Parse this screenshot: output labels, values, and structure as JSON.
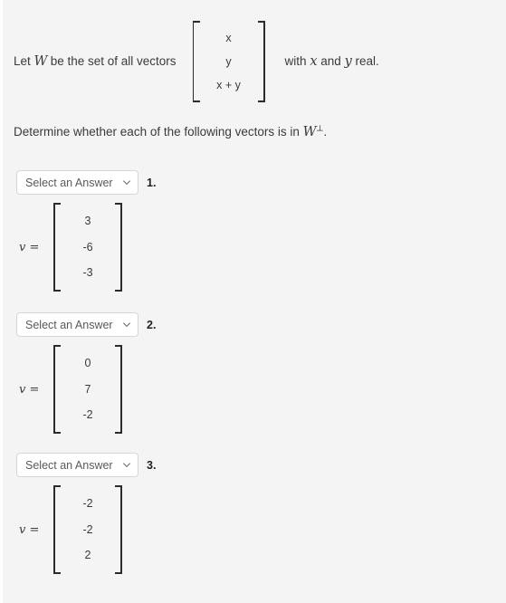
{
  "prompt": {
    "lead_text": "Let",
    "lead_var": "W",
    "lead_text2": "be the set of all vectors",
    "matrix": [
      "x",
      "y",
      "x + y"
    ],
    "trail_text": "with",
    "trail_var1": "x",
    "trail_and": "and",
    "trail_var2": "y",
    "trail_text2": "real.",
    "instruction_pre": "Determine whether each of the following vectors is in",
    "instruction_var": "W",
    "instruction_sup": "⊥",
    "instruction_post": "."
  },
  "select": {
    "placeholder": "Select an Answer",
    "chevron_icon": "chevron-down-icon",
    "options": [
      "Select an Answer"
    ]
  },
  "items": [
    {
      "number": "1.",
      "selected": "Select an Answer",
      "vector_label": "v =",
      "vector": [
        "3",
        "-6",
        "-3"
      ]
    },
    {
      "number": "2.",
      "selected": "Select an Answer",
      "vector_label": "v =",
      "vector": [
        "0",
        "7",
        "-2"
      ]
    },
    {
      "number": "3.",
      "selected": "Select an Answer",
      "vector_label": "v =",
      "vector": [
        "-2",
        "-2",
        "2"
      ]
    }
  ],
  "colors": {
    "background": "#f4f4f4",
    "text": "#3a3a3a",
    "bracket": "#2b2b2b",
    "select_border": "#d6d6d6",
    "select_bg": "#ffffff"
  }
}
